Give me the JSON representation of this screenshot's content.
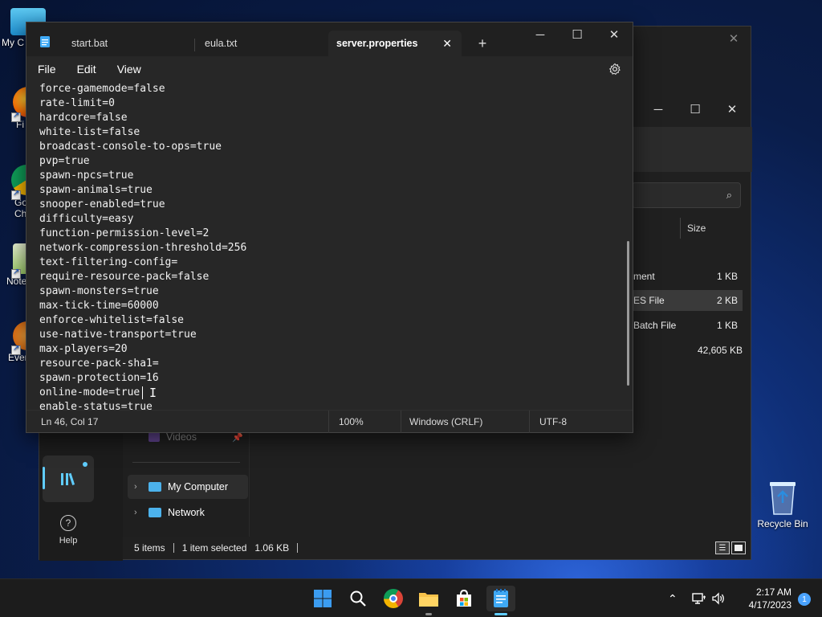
{
  "desktop": {
    "icons": [
      {
        "label": "My C"
      },
      {
        "label": "Fi"
      },
      {
        "label": "Go Ch"
      },
      {
        "label": "Note"
      },
      {
        "label": "Ever"
      }
    ],
    "recycle_bin": {
      "label": "Recycle Bin"
    }
  },
  "notepad": {
    "tabs": [
      {
        "label": "start.bat"
      },
      {
        "label": "eula.txt"
      },
      {
        "label": "server.properties"
      }
    ],
    "menu": [
      "File",
      "Edit",
      "View"
    ],
    "lines": [
      "force-gamemode=false",
      "rate-limit=0",
      "hardcore=false",
      "white-list=false",
      "broadcast-console-to-ops=true",
      "pvp=true",
      "spawn-npcs=true",
      "spawn-animals=true",
      "snooper-enabled=true",
      "difficulty=easy",
      "function-permission-level=2",
      "network-compression-threshold=256",
      "text-filtering-config=",
      "require-resource-pack=false",
      "spawn-monsters=true",
      "max-tick-time=60000",
      "enforce-whitelist=false",
      "use-native-transport=true",
      "max-players=20",
      "resource-pack-sha1=",
      "spawn-protection=16",
      "online-mode=true",
      "enable-status=true"
    ],
    "status": {
      "position": "Ln 46, Col 17",
      "zoom": "100%",
      "line_ending": "Windows (CRLF)",
      "encoding": "UTF-8"
    }
  },
  "explorer": {
    "column_size": "Size",
    "files": [
      {
        "name": "ment",
        "size": "1 KB"
      },
      {
        "name": "ES File",
        "size": "2 KB"
      },
      {
        "name": "Batch File",
        "size": "1 KB"
      },
      {
        "name": "",
        "size": "42,605 KB"
      }
    ],
    "nav": {
      "videos": "Videos",
      "my_computer": "My Computer",
      "network": "Network"
    },
    "help_label": "Help",
    "status": {
      "items": "5 items",
      "selected": "1 item selected",
      "size": "1.06 KB"
    }
  },
  "taskbar": {
    "time": "2:17 AM",
    "date": "4/17/2023",
    "notification_count": "1"
  },
  "colors": {
    "accent": "#60cdff",
    "notepad_bg": "#272727",
    "titlebar": "#202020",
    "taskbar": "#1c1c1c"
  }
}
